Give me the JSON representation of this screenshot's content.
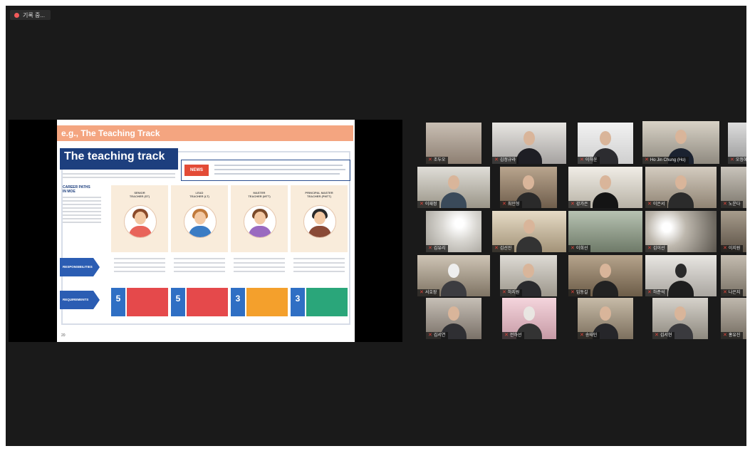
{
  "recording": {
    "label": "기록 중..."
  },
  "slide": {
    "banner": "e.g., The Teaching Track",
    "title": "The teaching track",
    "news_label": "NEWS",
    "left_heading": "CAREER PATHS\nIN MOE",
    "cards": [
      {
        "role": "SENIOR\nTEACHER (ST)",
        "hair": "#8a4a2a",
        "shirt": "#e8645a"
      },
      {
        "role": "LEAD\nTEACHER (LT)",
        "hair": "#c07a3c",
        "shirt": "#3b7cc4"
      },
      {
        "role": "MASTER\nTEACHER (MTT)",
        "hair": "#7a4a2a",
        "shirt": "#9a6ac0"
      },
      {
        "role": "PRINCIPAL MASTER\nTEACHER (PMTT)",
        "hair": "#2a2a2a",
        "shirt": "#8a4a36"
      }
    ],
    "responsibilities_label": "RESPONSIBILITIES",
    "requirements_label": "REQUIREMENTS",
    "req_numbers": [
      "5",
      "5",
      "3",
      "3"
    ],
    "slide_number": "20"
  },
  "participants": [
    {
      "name": "조두오"
    },
    {
      "name": "김정규라"
    },
    {
      "name": "이하윤"
    },
    {
      "name": "Ho Jin Chung (Ho)"
    },
    {
      "name": "오정혜"
    },
    {
      "name": "이재정"
    },
    {
      "name": "최민형"
    },
    {
      "name": "강가은"
    },
    {
      "name": "이은서"
    },
    {
      "name": "노운다"
    },
    {
      "name": "김유리"
    },
    {
      "name": "김선진"
    },
    {
      "name": "이희선"
    },
    {
      "name": "김이선"
    },
    {
      "name": "이지원"
    },
    {
      "name": "서호장"
    },
    {
      "name": "하지원"
    },
    {
      "name": "임동길"
    },
    {
      "name": "하준석"
    },
    {
      "name": "나은지"
    },
    {
      "name": "김서연"
    },
    {
      "name": "전하선"
    },
    {
      "name": "송태민"
    },
    {
      "name": "김서현"
    },
    {
      "name": "홍유진"
    }
  ],
  "colors": {
    "active_speaker_outline": "#bde05c",
    "muted_mic": "#e0453a",
    "app_background": "#1a1a1a"
  }
}
